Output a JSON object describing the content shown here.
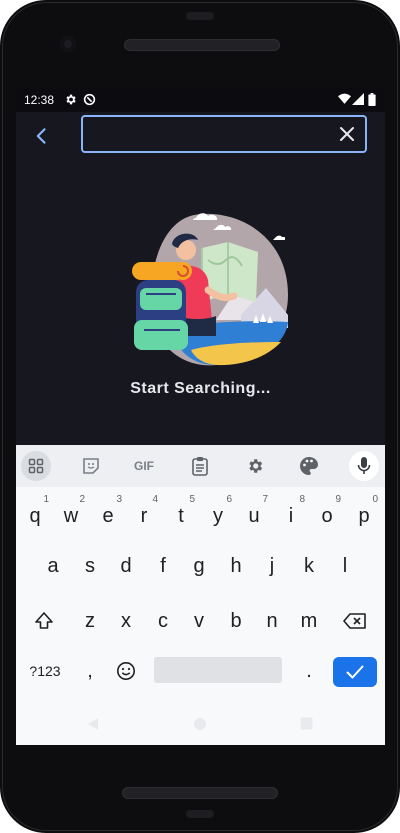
{
  "status_bar": {
    "time": "12:38"
  },
  "search": {
    "value": "",
    "placeholder": ""
  },
  "empty_state": {
    "message": "Start Searching..."
  },
  "keyboard": {
    "toolbar": {
      "gif_label": "GIF"
    },
    "rows": [
      [
        "q",
        "w",
        "e",
        "r",
        "t",
        "y",
        "u",
        "i",
        "o",
        "p"
      ],
      [
        "a",
        "s",
        "d",
        "f",
        "g",
        "h",
        "j",
        "k",
        "l"
      ],
      [
        "z",
        "x",
        "c",
        "v",
        "b",
        "n",
        "m"
      ]
    ],
    "number_hints": [
      "1",
      "2",
      "3",
      "4",
      "5",
      "6",
      "7",
      "8",
      "9",
      "0"
    ],
    "symbols_label": "?123",
    "comma_label": ",",
    "period_label": "."
  },
  "colors": {
    "screen_background": "#171720",
    "search_border": "#8ab4f8",
    "accent": "#1a73e8",
    "keyboard_background": "#f8f9fa"
  },
  "icons": {
    "back": "arrow-back-icon",
    "clear": "close-icon",
    "wifi": "wifi-icon",
    "signal": "signal-icon",
    "battery": "battery-icon"
  }
}
